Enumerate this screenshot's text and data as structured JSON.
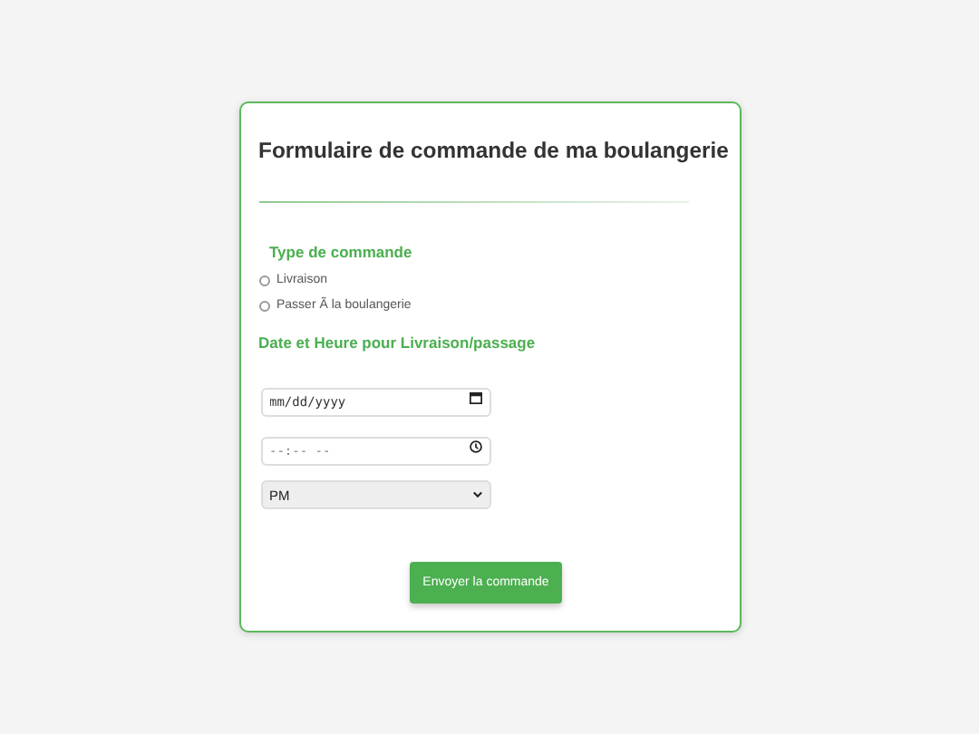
{
  "form": {
    "title": "Formulaire de commande de ma boulangerie",
    "order_type": {
      "heading": "Type de commande",
      "options": [
        {
          "label": "Livraison",
          "selected": false
        },
        {
          "label": "Passer Ã  la boulangerie",
          "selected": false
        }
      ]
    },
    "datetime": {
      "heading": "Date et Heure pour Livraison/passage",
      "date": {
        "placeholder": "mm/dd/yyyy"
      },
      "time": {
        "placeholder": "--:-- --"
      },
      "period": {
        "value": "PM"
      }
    },
    "submit": "Envoyer la commande"
  }
}
